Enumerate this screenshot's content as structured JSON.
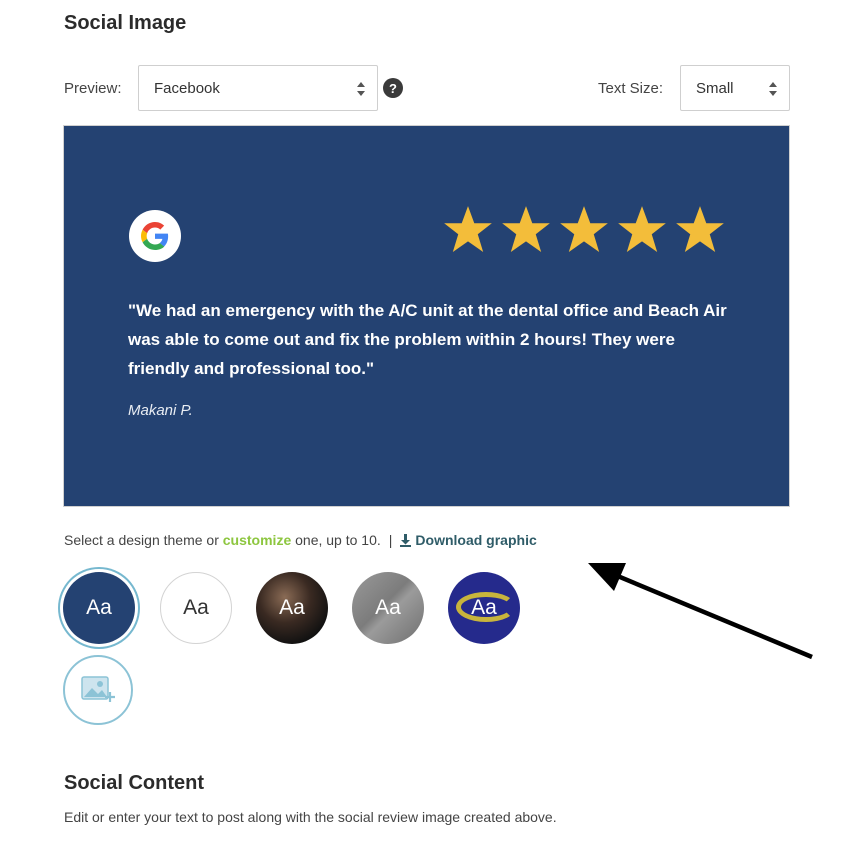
{
  "social_image": {
    "title": "Social Image",
    "preview_label": "Preview:",
    "preview_value": "Facebook",
    "help": "?",
    "text_size_label": "Text Size:",
    "text_size_value": "Small"
  },
  "review": {
    "source_icon": "google-icon",
    "rating": 5,
    "quote": "\"We had an emergency with the A/C unit at the dental office and Beach Air was able to come out and fix the problem within 2 hours! They were friendly and professional too.\"",
    "author": "Makani P.",
    "background": "#244272",
    "star_color": "#f3bd3a"
  },
  "theme_section": {
    "text_before": "Select a design theme or ",
    "customize_link": "customize",
    "text_after": " one, up to 10.",
    "separator": "|",
    "download_label": "Download graphic",
    "themes": [
      {
        "label": "Aa",
        "selected": true
      },
      {
        "label": "Aa",
        "selected": false
      },
      {
        "label": "Aa",
        "selected": false
      },
      {
        "label": "Aa",
        "selected": false
      },
      {
        "label": "Aa",
        "selected": false
      }
    ],
    "upload_icon": "image-add-icon"
  },
  "social_content": {
    "title": "Social Content",
    "description": "Edit or enter your text to post along with the social review image created above."
  },
  "colors": {
    "accent_green": "#8dc63f",
    "link_teal": "#2f5c68",
    "selected_ring": "#76b8cf"
  }
}
